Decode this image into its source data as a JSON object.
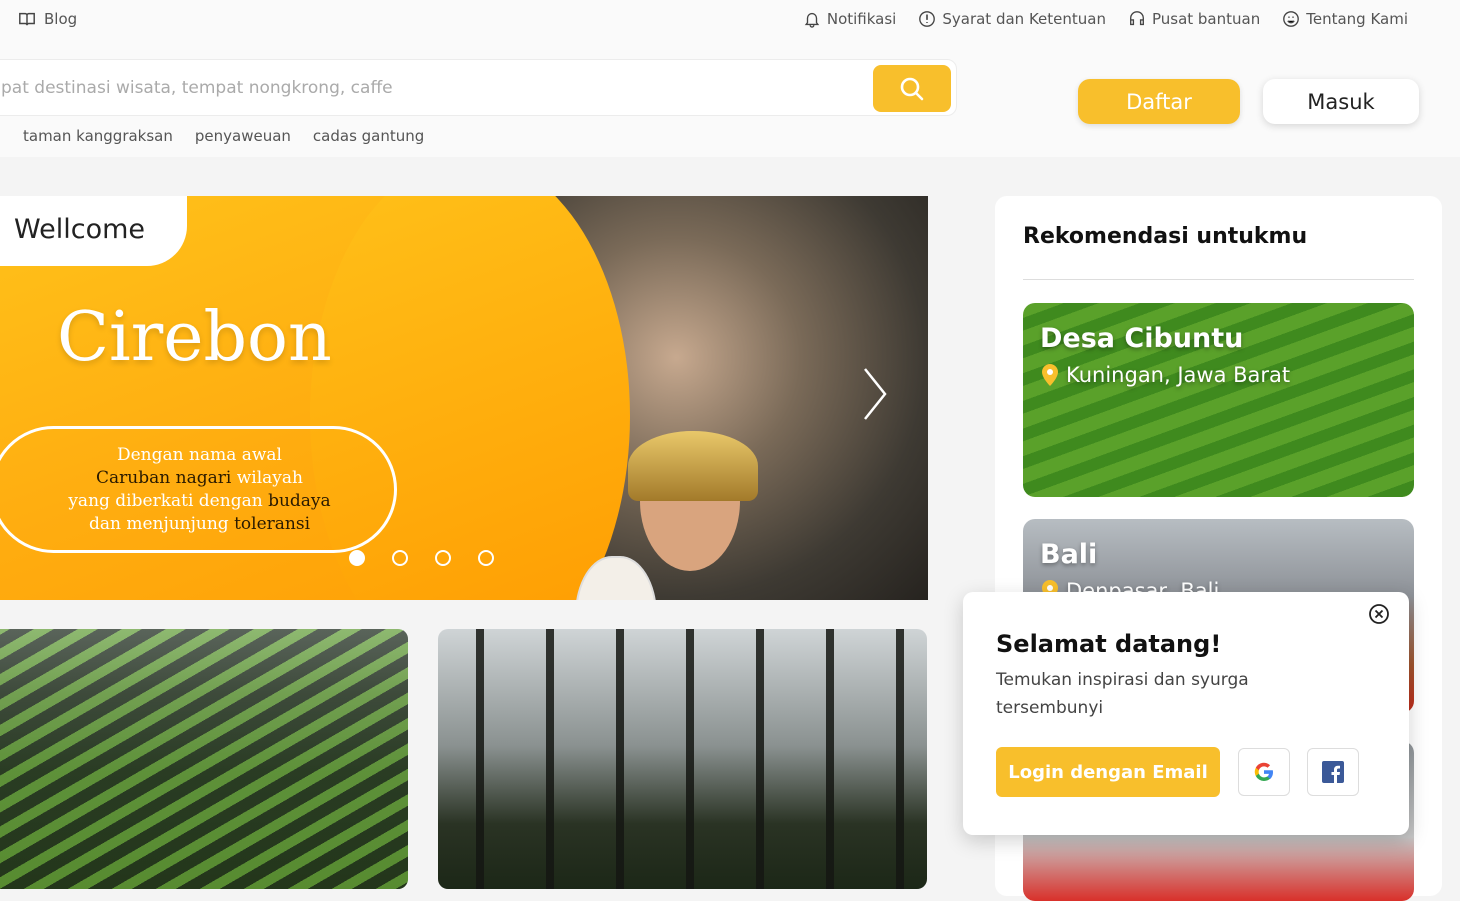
{
  "topbar": {
    "blog": "Blog",
    "links": [
      "Notifikasi",
      "Syarat dan Ketentuan",
      "Pusat bantuan",
      "Tentang Kami"
    ]
  },
  "search": {
    "placeholder": "pat destinasi wisata, tempat nongkrong, caffe",
    "quick": [
      "taman kanggraksan",
      "penyaweuan",
      "cadas gantung"
    ]
  },
  "auth": {
    "daftar": "Daftar",
    "masuk": "Masuk"
  },
  "banner": {
    "welcome": "Wellcome",
    "city": "Cirebon",
    "tagline": {
      "l1": "Dengan nama awal",
      "l2a": "Caruban nagari",
      "l2b": " wilayah",
      "l3a": "yang diberkati dengan ",
      "l3b": "budaya",
      "l4a": "dan menjunjung ",
      "l4b": "toleransi"
    },
    "slides_total": 4,
    "slide_active": 1
  },
  "sidebar": {
    "title": "Rekomendasi untukmu",
    "items": [
      {
        "name": "Desa Cibuntu",
        "location": "Kuningan, Jawa Barat"
      },
      {
        "name": "Bali",
        "location": "Denpasar, Bali"
      }
    ]
  },
  "popup": {
    "title": "Selamat datang!",
    "text": "Temukan inspirasi dan syurga tersembunyi",
    "login_email": "Login dengan Email",
    "social": [
      "google-icon",
      "facebook-icon"
    ]
  },
  "colors": {
    "accent": "#f8bf2c",
    "banner": "#ffad10",
    "facebook": "#3b5998"
  }
}
